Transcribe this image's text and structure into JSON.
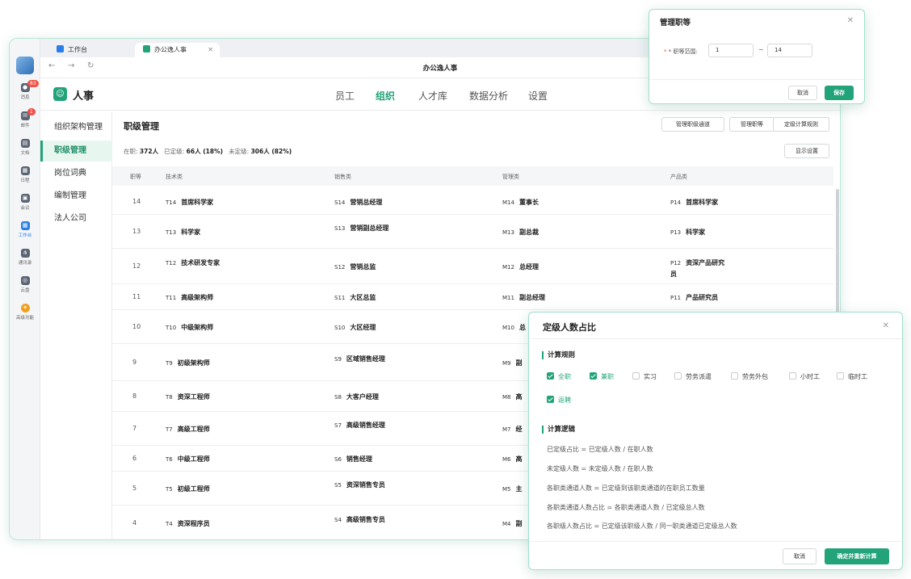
{
  "dock": {
    "items": [
      {
        "label": "消息",
        "badge": "83"
      },
      {
        "label": "邮件",
        "badge": "1"
      },
      {
        "label": "文档"
      },
      {
        "label": "日程"
      },
      {
        "label": "会议"
      },
      {
        "label": "工作台"
      },
      {
        "label": "通讯录"
      },
      {
        "label": "云盘"
      },
      {
        "label": "高级功能"
      }
    ]
  },
  "tabs": [
    {
      "label": "工作台"
    },
    {
      "label": "办公逸人事"
    }
  ],
  "address": {
    "title": "办公逸人事"
  },
  "app": {
    "name": "人事"
  },
  "topnav": [
    "员工",
    "组织",
    "人才库",
    "数据分析",
    "设置"
  ],
  "left_menu": [
    "组织架构管理",
    "职级管理",
    "岗位词典",
    "编制管理",
    "法人公司"
  ],
  "page": {
    "title": "职级管理",
    "buttons": [
      "管理职级通道",
      "管理职等",
      "定级计算规则"
    ],
    "display_button": "显示设置",
    "stats": {
      "l1": "在职:",
      "v1": "372人",
      "l2": "已定级:",
      "v2": "66人 (18%)",
      "l3": "未定级:",
      "v3": "306人 (82%)"
    }
  },
  "table": {
    "headers": [
      "职等",
      "技术类",
      "销售类",
      "管理类",
      "产品类"
    ],
    "rows": [
      {
        "level": "14",
        "tech": [
          "T14",
          "首席科学家"
        ],
        "sales": [
          "S14",
          "营销总经理"
        ],
        "mgmt": [
          "M14",
          "董事长"
        ],
        "prod": [
          "P14",
          "首席科学家"
        ]
      },
      {
        "level": "13",
        "tech": [
          "T13",
          "科学家"
        ],
        "sales": [
          "S13",
          "营销副总经理"
        ],
        "mgmt": [
          "M13",
          "副总裁"
        ],
        "prod": [
          "P13",
          "科学家"
        ]
      },
      {
        "level": "12",
        "tech": [
          "T12",
          "技术研发专家"
        ],
        "sales": [
          "S12",
          "营销总监"
        ],
        "mgmt": [
          "M12",
          "总经理"
        ],
        "prod": [
          "P12",
          "资深产品研究员"
        ]
      },
      {
        "level": "11",
        "tech": [
          "T11",
          "高级架构师"
        ],
        "sales": [
          "S11",
          "大区总监"
        ],
        "mgmt": [
          "M11",
          "副总经理"
        ],
        "prod": [
          "P11",
          "产品研究员"
        ]
      },
      {
        "level": "10",
        "tech": [
          "T10",
          "中级架构师"
        ],
        "sales": [
          "S10",
          "大区经理"
        ],
        "mgmt": [
          "M10",
          "总"
        ],
        "prod": [
          "",
          ""
        ]
      },
      {
        "level": "9",
        "tech": [
          "T9",
          "初级架构师"
        ],
        "sales": [
          "S9",
          "区域销售经理"
        ],
        "mgmt": [
          "M9",
          "副"
        ],
        "prod": [
          "",
          ""
        ]
      },
      {
        "level": "8",
        "tech": [
          "T8",
          "资深工程师"
        ],
        "sales": [
          "S8",
          "大客户经理"
        ],
        "mgmt": [
          "M8",
          "高"
        ],
        "prod": [
          "",
          ""
        ]
      },
      {
        "level": "7",
        "tech": [
          "T7",
          "高级工程师"
        ],
        "sales": [
          "S7",
          "高级销售经理"
        ],
        "mgmt": [
          "M7",
          "经"
        ],
        "prod": [
          "",
          ""
        ]
      },
      {
        "level": "6",
        "tech": [
          "T6",
          "中级工程师"
        ],
        "sales": [
          "S6",
          "销售经理"
        ],
        "mgmt": [
          "M6",
          "高"
        ],
        "prod": [
          "",
          ""
        ]
      },
      {
        "level": "5",
        "tech": [
          "T5",
          "初级工程师"
        ],
        "sales": [
          "S5",
          "资深销售专员"
        ],
        "mgmt": [
          "M5",
          "主"
        ],
        "prod": [
          "",
          ""
        ]
      },
      {
        "level": "4",
        "tech": [
          "T4",
          "资深程序员"
        ],
        "sales": [
          "S4",
          "高级销售专员"
        ],
        "mgmt": [
          "M4",
          "副"
        ],
        "prod": [
          "",
          ""
        ]
      }
    ]
  },
  "dialog_grade": {
    "title": "管理职等",
    "range_label": "* 职等范围:",
    "from": "1",
    "sep": "~",
    "to": "14",
    "cancel": "取消",
    "save": "保存"
  },
  "dialog_ratio": {
    "title": "定级人数占比",
    "rules_title": "计算规则",
    "options": [
      {
        "label": "全职",
        "checked": true
      },
      {
        "label": "兼职",
        "checked": true
      },
      {
        "label": "实习",
        "checked": false
      },
      {
        "label": "劳务派遣",
        "checked": false
      },
      {
        "label": "劳务外包",
        "checked": false
      },
      {
        "label": "小时工",
        "checked": false
      },
      {
        "label": "临时工",
        "checked": false
      },
      {
        "label": "返聘",
        "checked": true
      }
    ],
    "logic_title": "计算逻辑",
    "logic": [
      "已定级占比 = 已定级人数 / 在职人数",
      "未定级人数 = 未定级人数 / 在职人数",
      "各职类通道人数 = 已定级到该职类通道的在职员工数量",
      "各职类通道人数占比 = 各职类通道人数 / 已定级总人数",
      "各职级人数占比 = 已定级该职级人数 / 同一职类通道已定级总人数"
    ],
    "cancel": "取消",
    "confirm": "确定并重新计算"
  },
  "colors": {
    "accent": "#22a37a",
    "badge": "#f04f45"
  }
}
